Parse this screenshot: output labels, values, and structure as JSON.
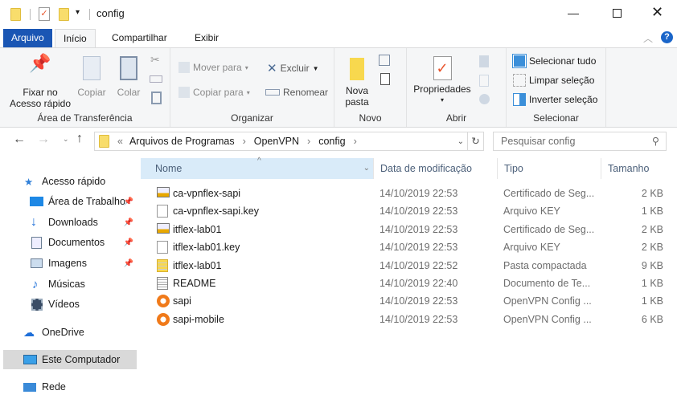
{
  "window": {
    "title": "config"
  },
  "ribbon_tabs": [
    "Arquivo",
    "Início",
    "Compartilhar",
    "Exibir"
  ],
  "ribbon": {
    "clipboard": {
      "label": "Área de Transferência",
      "pin": "Fixar no Acesso rápido",
      "pin_l1": "Fixar no",
      "pin_l2": "Acesso rápido",
      "copy": "Copiar",
      "paste": "Colar"
    },
    "organize": {
      "label": "Organizar",
      "move": "Mover para",
      "copy_to": "Copiar para",
      "delete": "Excluir",
      "rename": "Renomear"
    },
    "new": {
      "label": "Novo",
      "new_folder_l1": "Nova",
      "new_folder_l2": "pasta"
    },
    "open": {
      "label": "Abrir",
      "properties": "Propriedades"
    },
    "select": {
      "label": "Selecionar",
      "all": "Selecionar tudo",
      "none": "Limpar seleção",
      "invert": "Inverter seleção"
    }
  },
  "address": {
    "prefix": "«",
    "crumbs": [
      "Arquivos de Programas",
      "OpenVPN",
      "config"
    ]
  },
  "search": {
    "placeholder": "Pesquisar config"
  },
  "sidebar": {
    "quick": "Acesso rápido",
    "items": [
      "Área de Trabalho",
      "Downloads",
      "Documentos",
      "Imagens",
      "Músicas",
      "Vídeos"
    ],
    "onedrive": "OneDrive",
    "pc": "Este Computador",
    "net": "Rede"
  },
  "columns": [
    "Nome",
    "Data de modificação",
    "Tipo",
    "Tamanho"
  ],
  "files": [
    {
      "name": "ca-vpnflex-sapi",
      "date": "14/10/2019 22:53",
      "type": "Certificado de Seg...",
      "size": "2 KB",
      "icon": "cert"
    },
    {
      "name": "ca-vpnflex-sapi.key",
      "date": "14/10/2019 22:53",
      "type": "Arquivo KEY",
      "size": "1 KB",
      "icon": "file"
    },
    {
      "name": "itflex-lab01",
      "date": "14/10/2019 22:53",
      "type": "Certificado de Seg...",
      "size": "2 KB",
      "icon": "cert"
    },
    {
      "name": "itflex-lab01.key",
      "date": "14/10/2019 22:53",
      "type": "Arquivo KEY",
      "size": "2 KB",
      "icon": "file"
    },
    {
      "name": "itflex-lab01",
      "date": "14/10/2019 22:52",
      "type": "Pasta compactada",
      "size": "9 KB",
      "icon": "zip"
    },
    {
      "name": "README",
      "date": "14/10/2019 22:40",
      "type": "Documento de Te...",
      "size": "1 KB",
      "icon": "text"
    },
    {
      "name": "sapi",
      "date": "14/10/2019 22:53",
      "type": "OpenVPN Config ...",
      "size": "1 KB",
      "icon": "openvpn"
    },
    {
      "name": "sapi-mobile",
      "date": "14/10/2019 22:53",
      "type": "OpenVPN Config ...",
      "size": "6 KB",
      "icon": "openvpn"
    }
  ]
}
